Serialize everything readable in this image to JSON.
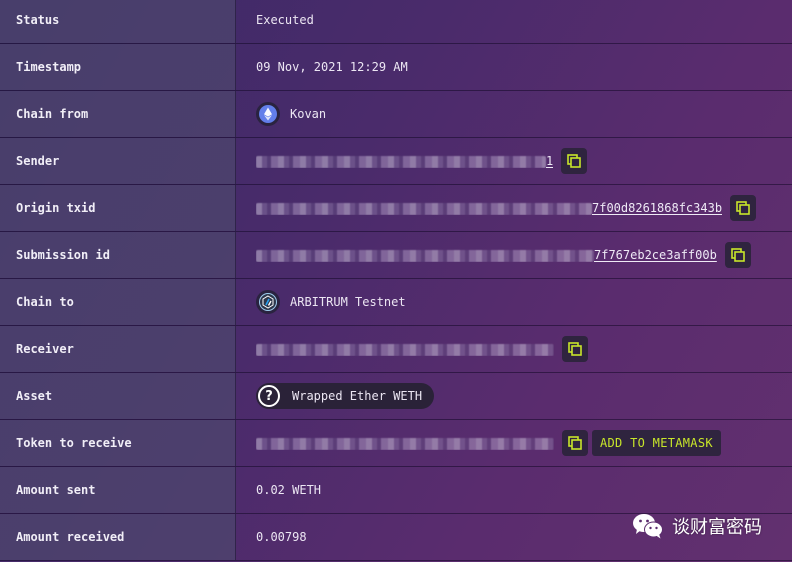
{
  "rows": {
    "status": {
      "label": "Status",
      "value": "Executed"
    },
    "timestamp": {
      "label": "Timestamp",
      "value": "09 Nov, 2021 12:29 AM"
    },
    "chain_from": {
      "label": "Chain from",
      "value": "Kovan",
      "icon": "ethereum-icon"
    },
    "sender": {
      "label": "Sender",
      "value_visible_tail": "1"
    },
    "origin_txid": {
      "label": "Origin txid",
      "value_visible_tail": "7f00d8261868fc343b"
    },
    "submission_id": {
      "label": "Submission id",
      "value_visible_tail": "7f767eb2ce3aff00b"
    },
    "chain_to": {
      "label": "Chain to",
      "value": "ARBITRUM Testnet",
      "icon": "arbitrum-icon"
    },
    "receiver": {
      "label": "Receiver"
    },
    "asset": {
      "label": "Asset",
      "value": "Wrapped Ether WETH",
      "icon": "question-icon"
    },
    "token_to_receive": {
      "label": "Token to receive",
      "button_label": "ADD TO METAMASK"
    },
    "amount_sent": {
      "label": "Amount sent",
      "value": "0.02 WETH"
    },
    "amount_received": {
      "label": "Amount received",
      "value": "0.00798"
    }
  },
  "watermark": {
    "text": "谈财富密码",
    "icon": "wechat-icon"
  },
  "colors": {
    "accent": "#c8e62a",
    "button_bg": "#2f243f",
    "label_bg": "#4e466e"
  }
}
